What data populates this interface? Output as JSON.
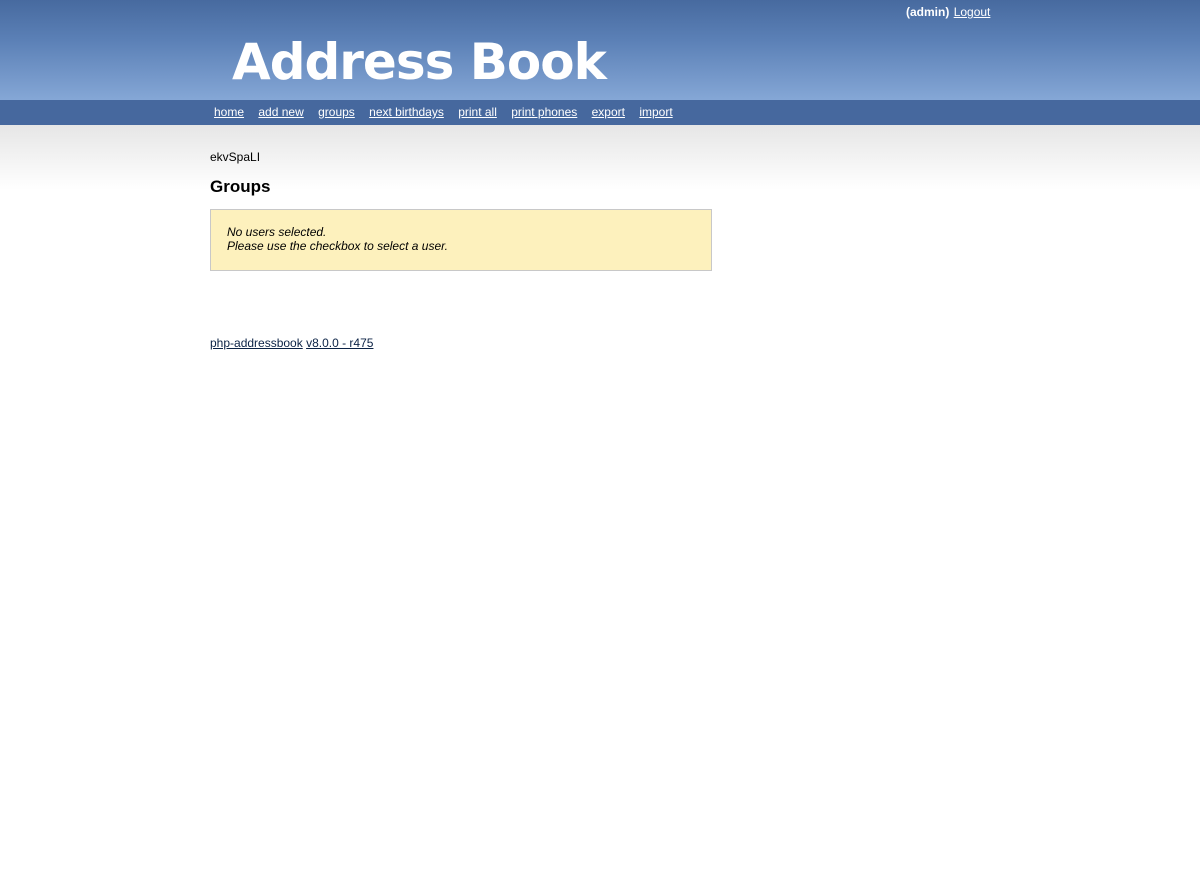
{
  "header": {
    "user": "(admin)",
    "logout_label": "Logout",
    "logo_text": "Address Book"
  },
  "nav": {
    "items": [
      {
        "label": "home"
      },
      {
        "label": "add new"
      },
      {
        "label": "groups"
      },
      {
        "label": "next birthdays"
      },
      {
        "label": "print all"
      },
      {
        "label": "print phones"
      },
      {
        "label": "export"
      },
      {
        "label": "import"
      }
    ]
  },
  "main": {
    "domain_label": "ekvSpaLI",
    "title": "Groups",
    "message_line1": "No users selected.",
    "message_line2": "Please use the checkbox to select a user."
  },
  "footer": {
    "app_link": "php-addressbook",
    "version_link": "v8.0.0 - r475"
  },
  "colors": {
    "header_top": "#476a9f",
    "header_bottom": "#85a7d6",
    "nav_bg": "#46689e",
    "message_bg": "#fdf1bd"
  }
}
